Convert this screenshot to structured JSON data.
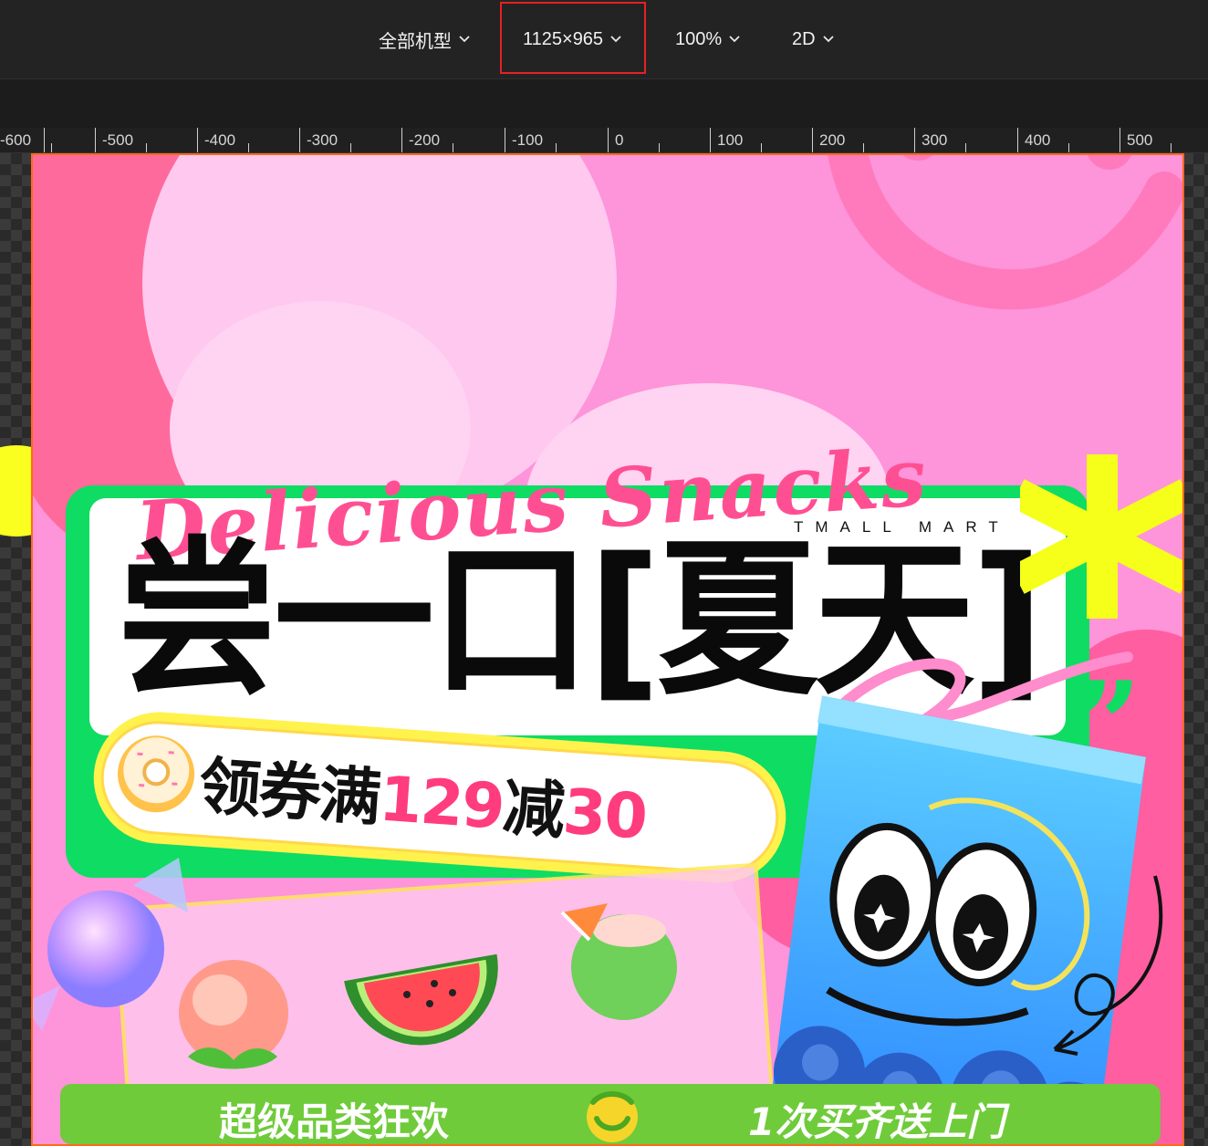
{
  "toolbar": {
    "device_label": "全部机型",
    "size_label": "1125×965",
    "zoom_label": "100%",
    "mode_label": "2D"
  },
  "ruler": {
    "labels": [
      "-600",
      "-500",
      "-400",
      "-300",
      "-200",
      "-100",
      "0",
      "100",
      "200",
      "300",
      "400",
      "500"
    ]
  },
  "banner": {
    "script_title": "Delicious Snacks",
    "brand_caption": "TMALL MART",
    "headline": "尝一口[夏天]",
    "coupon": {
      "prefix": "领券满",
      "amount": "129",
      "middle": "减",
      "discount": "30"
    },
    "bottom_left": "超级品类狂欢",
    "bottom_right": "1次买齐送上门"
  },
  "colors": {
    "banner_bg": "#fe94d9",
    "accent_pink": "#ff3c7e",
    "green_frame": "#0fdc63",
    "bottom_bar": "#6fcb3a",
    "highlight_red": "#e52222",
    "selection_orange": "#ff6a1a"
  }
}
